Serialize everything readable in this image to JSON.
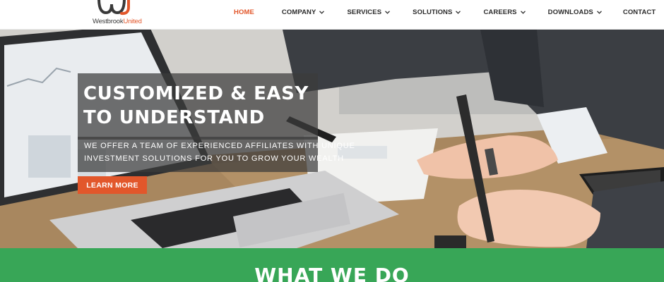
{
  "brand": {
    "logo_text_main": "Westbrook",
    "logo_text_accent": "United",
    "colors": {
      "accent": "#e2572b",
      "green": "#38a657",
      "dark": "#3a3a3a"
    }
  },
  "nav": {
    "items": [
      {
        "label": "HOME",
        "active": true,
        "dropdown": false
      },
      {
        "label": "COMPANY",
        "active": false,
        "dropdown": true
      },
      {
        "label": "SERVICES",
        "active": false,
        "dropdown": true
      },
      {
        "label": "SOLUTIONS",
        "active": false,
        "dropdown": true
      },
      {
        "label": "CAREERS",
        "active": false,
        "dropdown": true
      },
      {
        "label": "DOWNLOADS",
        "active": false,
        "dropdown": true
      },
      {
        "label": "CONTACT",
        "active": false,
        "dropdown": false
      }
    ],
    "dropdown_icon": "chevron-down-icon"
  },
  "hero": {
    "title_line1": "CUSTOMIZED & EASY",
    "title_line2": "TO UNDERSTAND",
    "subtitle_line1": "WE OFFER A TEAM OF EXPERIENCED AFFILIATES WITH UNIQUE",
    "subtitle_line2": "INVESTMENT SOLUTIONS FOR YOU TO GROW YOUR WEALTH",
    "cta_label": "LEARN MORE"
  },
  "section": {
    "title": "WHAT WE DO"
  }
}
